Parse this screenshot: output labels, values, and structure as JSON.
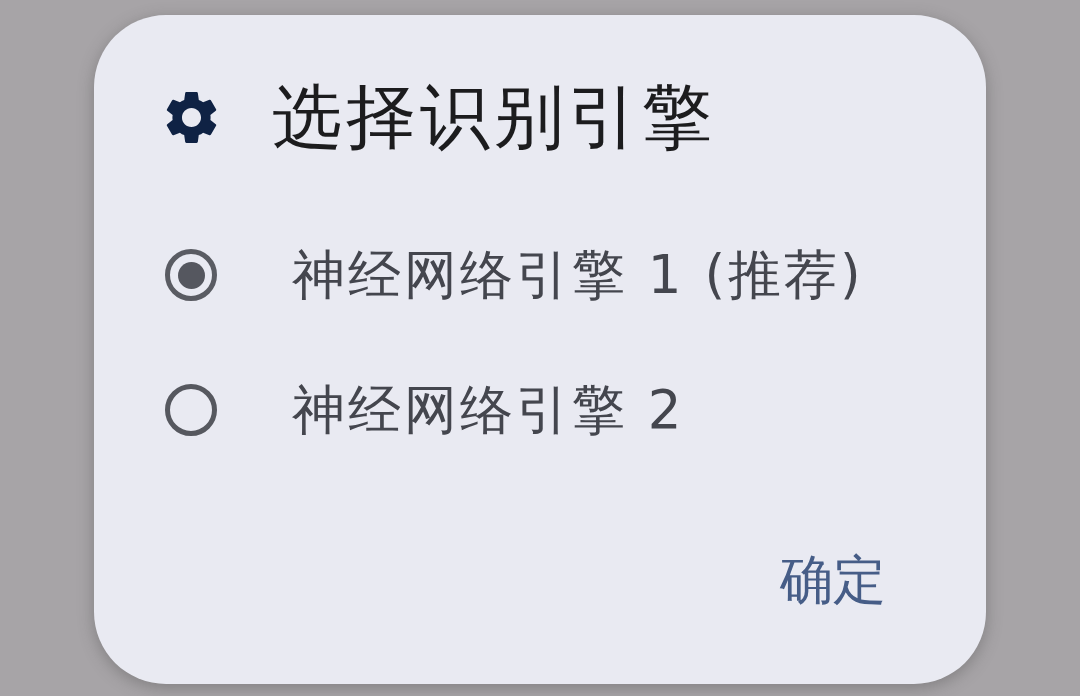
{
  "dialog": {
    "title": "选择识别引擎",
    "options": [
      {
        "label": "神经网络引擎 1 (推荐)",
        "selected": true
      },
      {
        "label": "神经网络引擎 2",
        "selected": false
      }
    ],
    "buttons": [
      "确定"
    ]
  }
}
